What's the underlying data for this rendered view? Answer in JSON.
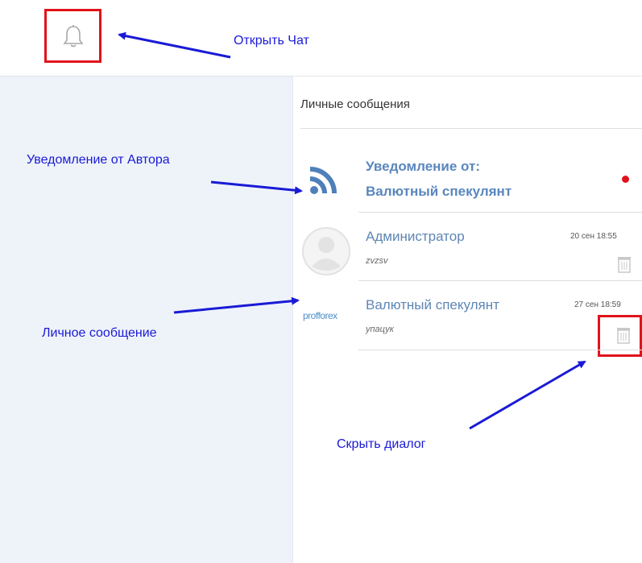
{
  "header": {
    "bell_icon": "bell-icon"
  },
  "chat": {
    "title": "Личные сообщения",
    "items": [
      {
        "name_line1": "Уведомление от:",
        "name_line2": "Валютный спекулянт",
        "unread": true,
        "icon": "rss-icon"
      },
      {
        "name": "Администратор",
        "preview": "zvzsv",
        "date": "20 сен 18:55",
        "icon": "avatar-icon"
      },
      {
        "name": "Валютный спекулянт",
        "preview": "упацук",
        "date": "27 сен 18:59",
        "logo": "profforex"
      }
    ]
  },
  "annotations": {
    "open_chat": "Открыть Чат",
    "author_notification": "Уведомление от Автора",
    "private_message": "Личное сообщение",
    "hide_dialog": "Скрыть диалог"
  },
  "colors": {
    "highlight": "#e0131b",
    "annotation": "#1a1ad6",
    "accent": "#5a86be"
  }
}
